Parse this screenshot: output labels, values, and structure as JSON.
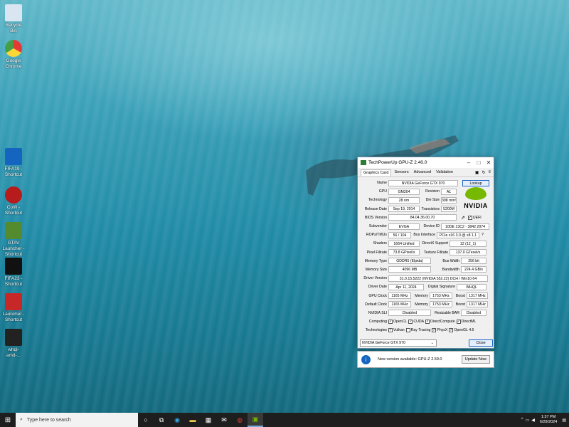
{
  "desktop_icons": [
    {
      "label": "Recycle Bin",
      "color": "#d9e6f2"
    },
    {
      "label": "Google Chrome",
      "color": "#e53935"
    },
    {
      "label": "FIFA19 - Shortcut",
      "color": "#1565c0"
    },
    {
      "label": "CoW - Shortcut",
      "color": "#b71c1c"
    },
    {
      "label": "GTAV Launcher - Shortcut",
      "color": "#558b2f"
    },
    {
      "label": "FIFA23 - Shortcut",
      "color": "#111111"
    },
    {
      "label": "Launcher - Shortcut",
      "color": "#c62828"
    },
    {
      "label": "whql-amd-...",
      "color": "#222222"
    }
  ],
  "window": {
    "title": "TechPowerUp GPU-Z 2.40.0",
    "tabs": [
      "Graphics Card",
      "Sensors",
      "Advanced",
      "Validation"
    ],
    "fields": {
      "name_label": "Name",
      "name": "NVIDIA GeForce GTX 970",
      "lookup": "Lookup",
      "gpu_label": "GPU",
      "gpu": "GM204",
      "revision_label": "Revision",
      "revision": "A1",
      "tech_label": "Technology",
      "tech": "28 nm",
      "die_label": "Die Size",
      "die": "398 mm²",
      "release_label": "Release Date",
      "release": "Sep 19, 2014",
      "trans_label": "Transistors",
      "trans": "5200M",
      "bios_label": "BIOS Version",
      "bios": "84.04.36.00.70",
      "uefi": "UEFI",
      "subvendor_label": "Subvendor",
      "subvendor": "EVGA",
      "devid_label": "Device ID",
      "devid": "10DE 13C2 - 3842 2974",
      "rops_label": "ROPs/TMUs",
      "rops": "56 / 104",
      "bus_label": "Bus Interface",
      "bus": "PCIe x16 3.0 @ x8 1.1",
      "bus_q": "?",
      "shaders_label": "Shaders",
      "shaders": "1664 Unified",
      "dx_label": "DirectX Support",
      "dx": "12 (12_1)",
      "pixel_label": "Pixel Fillrate",
      "pixel": "73.8 GPixel/s",
      "texture_label": "Texture Fillrate",
      "texture": "137.0 GTexel/s",
      "memtype_label": "Memory Type",
      "memtype": "GDDR5 (Elpida)",
      "buswidth_label": "Bus Width",
      "buswidth": "256 bit",
      "memsize_label": "Memory Size",
      "memsize": "4096 MB",
      "bandwidth_label": "Bandwidth",
      "bandwidth": "224.4 GB/s",
      "driver_label": "Driver Version",
      "driver": "31.0.15.5222 (NVIDIA 552.22) DCH / Win10 64",
      "driverdate_label": "Driver Date",
      "driverdate": "Apr 11, 2024",
      "sig_label": "Digital Signature",
      "sig": "WHQL",
      "gpuclock_label": "GPU Clock",
      "gpuclock": "1165 MHz",
      "mem_label": "Memory",
      "gpumem": "1753 MHz",
      "boost_label": "Boost",
      "gpuboost": "1317 MHz",
      "defclock_label": "Default Clock",
      "defclock": "1165 MHz",
      "defmem": "1753 MHz",
      "defboost": "1317 MHz",
      "sli_label": "NVIDIA SLI",
      "sli": "Disabled",
      "rebar_label": "Resizable BAR",
      "rebar": "Disabled",
      "computing_label": "Computing",
      "tech2_label": "Technologies"
    },
    "computing": [
      "OpenCL",
      "CUDA",
      "DirectCompute",
      "DirectML"
    ],
    "technologies": [
      "Vulkan",
      "Ray Tracing",
      "PhysX",
      "OpenGL 4.6"
    ],
    "technologies_checked": [
      true,
      false,
      true,
      true
    ],
    "logo_text": "NVIDIA",
    "select_value": "NVIDIA GeForce GTX 970",
    "close": "Close"
  },
  "notification": {
    "text": "New version available: GPU-Z 2.59.0",
    "button": "Update Now"
  },
  "taskbar": {
    "search_placeholder": "Type here to search",
    "time": "1:37 PM",
    "date": "6/29/2024"
  }
}
